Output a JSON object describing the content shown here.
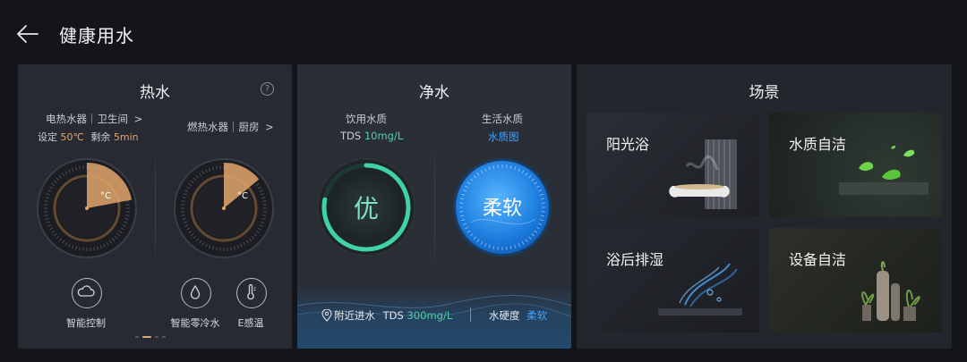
{
  "header": {
    "title": "健康用水",
    "back_icon": "arrow-left-icon"
  },
  "hot_water": {
    "title": "热水",
    "help_icon": "question-icon",
    "help_glyph": "?",
    "electric": {
      "label": "电热水器｜卫生间",
      "chevron": ">",
      "set_label": "设定",
      "set_value": "50℃",
      "remain_label": "剩余",
      "remain_value": "5min",
      "unit": "°C",
      "level": 0.22
    },
    "gas": {
      "label": "燃热水器｜厨房",
      "chevron": ">",
      "unit": "°C",
      "level": 0.14
    },
    "buttons": [
      {
        "label": "智能控制",
        "icon": "cloud-icon"
      },
      {
        "label": "智能零冷水",
        "icon": "water-drop-icon"
      },
      {
        "label": "E感温",
        "icon": "thermometer-icon"
      }
    ],
    "page_indicator": {
      "count": 4,
      "active": 1
    },
    "colors": {
      "accent": "#e2a46a"
    }
  },
  "pure_water": {
    "title": "净水",
    "drink": {
      "label": "饮用水质",
      "tds_label": "TDS",
      "tds_value": "10mg/L",
      "grade": "优"
    },
    "life": {
      "label": "生活水质",
      "link": "水质图",
      "grade": "柔软"
    },
    "footer": {
      "location_icon": "location-pin-icon",
      "inlet_label": "附近进水",
      "tds_label": "TDS",
      "tds_value": "300mg/L",
      "hardness_label": "水硬度",
      "hardness_value": "柔软"
    },
    "colors": {
      "green": "#4ed2a3",
      "blue": "#3fa3ff"
    }
  },
  "scenes": {
    "title": "场景",
    "tiles": [
      {
        "label": "阳光浴"
      },
      {
        "label": "水质自洁"
      },
      {
        "label": "浴后排湿"
      },
      {
        "label": "设备自洁"
      }
    ]
  }
}
